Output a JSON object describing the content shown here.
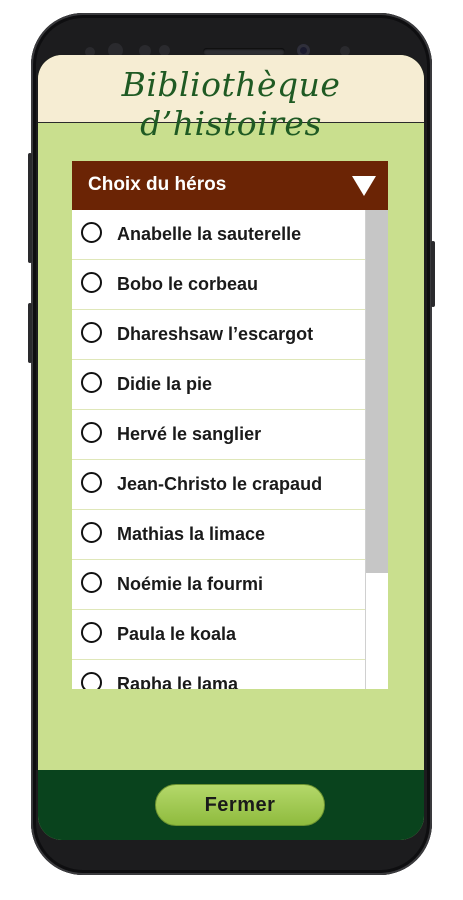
{
  "app": {
    "title": "Bibliothèque d’histoires"
  },
  "dropdown": {
    "title": "Choix du héros",
    "items": [
      {
        "label": "Anabelle la sauterelle"
      },
      {
        "label": "Bobo le corbeau"
      },
      {
        "label": "Dhareshsaw l’escargot"
      },
      {
        "label": "Didie la pie"
      },
      {
        "label": "Hervé le sanglier"
      },
      {
        "label": "Jean-Christo le crapaud"
      },
      {
        "label": "Mathias la limace"
      },
      {
        "label": "Noémie la fourmi"
      },
      {
        "label": "Paula le koala"
      },
      {
        "label": "Rapha le lama"
      }
    ]
  },
  "footer": {
    "close_label": "Fermer"
  },
  "colors": {
    "screen_background": "#c9df8e",
    "title_background": "#f6edd3",
    "title_text": "#1f5a23",
    "dropdown_header": "#6b2405",
    "footer_background": "#09431d",
    "button_fill": "#a6cc55"
  }
}
